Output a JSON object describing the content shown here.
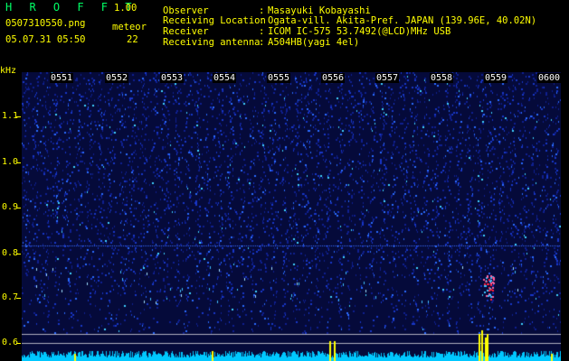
{
  "header": {
    "app_name": "H R O F F T",
    "version": "1.00",
    "filename": "0507310550.png",
    "datetime": "05.07.31 05:50",
    "meteor_label": "meteor",
    "meteor_count": "22"
  },
  "info": [
    {
      "label": "Observer",
      "value": "Masayuki Kobayashi"
    },
    {
      "label": "Receiving Location",
      "value": "Ogata-vill. Akita-Pref. JAPAN (139.96E, 40.02N)"
    },
    {
      "label": "Receiver",
      "value": "ICOM IC-575 53.7492(@LCD)MHz USB"
    },
    {
      "label": "Receiving antenna",
      "value": "A504HB(yagi 4el)"
    }
  ],
  "separator": ":",
  "axis": {
    "unit": "kHz",
    "ticks": [
      "1.1",
      "1.0",
      "0.9",
      "0.8",
      "0.7",
      "0.6"
    ]
  },
  "time_labels": [
    "0551",
    "0552",
    "0553",
    "0554",
    "0555",
    "0556",
    "0557",
    "0558",
    "0559",
    "0600"
  ],
  "colors": {
    "background": "#000000",
    "spectrogram_base": "#0a1a7a",
    "signal_line": "#3a6bff",
    "text_yellow": "#ffff00",
    "title_green": "#00ff66",
    "baseline_cyan": "#00c8ff",
    "meteor_red": "#ff2040"
  }
}
